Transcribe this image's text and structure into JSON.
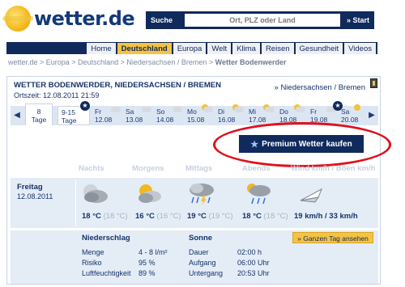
{
  "header": {
    "logo_text": "wetter.de",
    "search_label": "Suche",
    "search_placeholder": "Ort, PLZ oder Land",
    "search_button": "» Start"
  },
  "nav": [
    "Home",
    "Deutschland",
    "Europa",
    "Welt",
    "Klima",
    "Reisen",
    "Gesundheit",
    "Videos"
  ],
  "nav_active": "Deutschland",
  "breadcrumb": {
    "path": "wetter.de > Europa > Deutschland > Niedersachsen / Bremen > ",
    "current": "Wetter Bodenwerder"
  },
  "location": {
    "title": "WETTER BODENWERDER, NIEDERSACHSEN / BREMEN",
    "ortszeit": "Ortszeit: 12.08.2011 21:59",
    "region_link": "» Niedersachsen / Bremen"
  },
  "days": [
    {
      "l1": "8",
      "l2": "Tage"
    },
    {
      "l1": "9-15",
      "l2": "Tage"
    },
    {
      "l1": "Fr",
      "l2": "12.08"
    },
    {
      "l1": "Sa",
      "l2": "13.08"
    },
    {
      "l1": "So",
      "l2": "14.08"
    },
    {
      "l1": "Mo",
      "l2": "15.08"
    },
    {
      "l1": "Di",
      "l2": "16.08"
    },
    {
      "l1": "Mi",
      "l2": "17.08"
    },
    {
      "l1": "Do",
      "l2": "18.08"
    },
    {
      "l1": "Fr",
      "l2": "19.08"
    },
    {
      "l1": "Sa",
      "l2": "20.08"
    }
  ],
  "premium_button": "Premium Wetter kaufen",
  "columns": [
    "Nachts",
    "Morgens",
    "Mittags",
    "Abends",
    "Wind km/h / Böen km/h"
  ],
  "forecast": {
    "day": "Freitag",
    "date": "12.08.2011",
    "temps": [
      {
        "main": "18 °C",
        "feel": "(18 °C)"
      },
      {
        "main": "16 °C",
        "feel": "(16 °C)"
      },
      {
        "main": "19 °C",
        "feel": "(19 °C)"
      },
      {
        "main": "18 °C",
        "feel": "(18 °C)"
      }
    ],
    "wind": "19 km/h / 33 km/h",
    "icons": [
      "cloudy-night-icon",
      "partly-sunny-icon",
      "thunderstorm-icon",
      "rain-icon",
      "wind-direction-icon"
    ]
  },
  "niederschlag": {
    "title": "Niederschlag",
    "rows": [
      {
        "label": "Menge",
        "value": "4 - 8 l/m²"
      },
      {
        "label": "Risiko",
        "value": "95 %"
      },
      {
        "label": "Luftfeuchtigkeit",
        "value": "89 %"
      }
    ]
  },
  "sonne": {
    "title": "Sonne",
    "rows": [
      {
        "label": "Dauer",
        "value": "02:00 h"
      },
      {
        "label": "Aufgang",
        "value": "06:00 Uhr"
      },
      {
        "label": "Untergang",
        "value": "20:53 Uhr"
      }
    ]
  },
  "ganzen_tag_button": "» Ganzen Tag ansehen",
  "colors": {
    "navy": "#102a5c",
    "gold": "#f5c342",
    "highlight_red": "#e0101a"
  }
}
